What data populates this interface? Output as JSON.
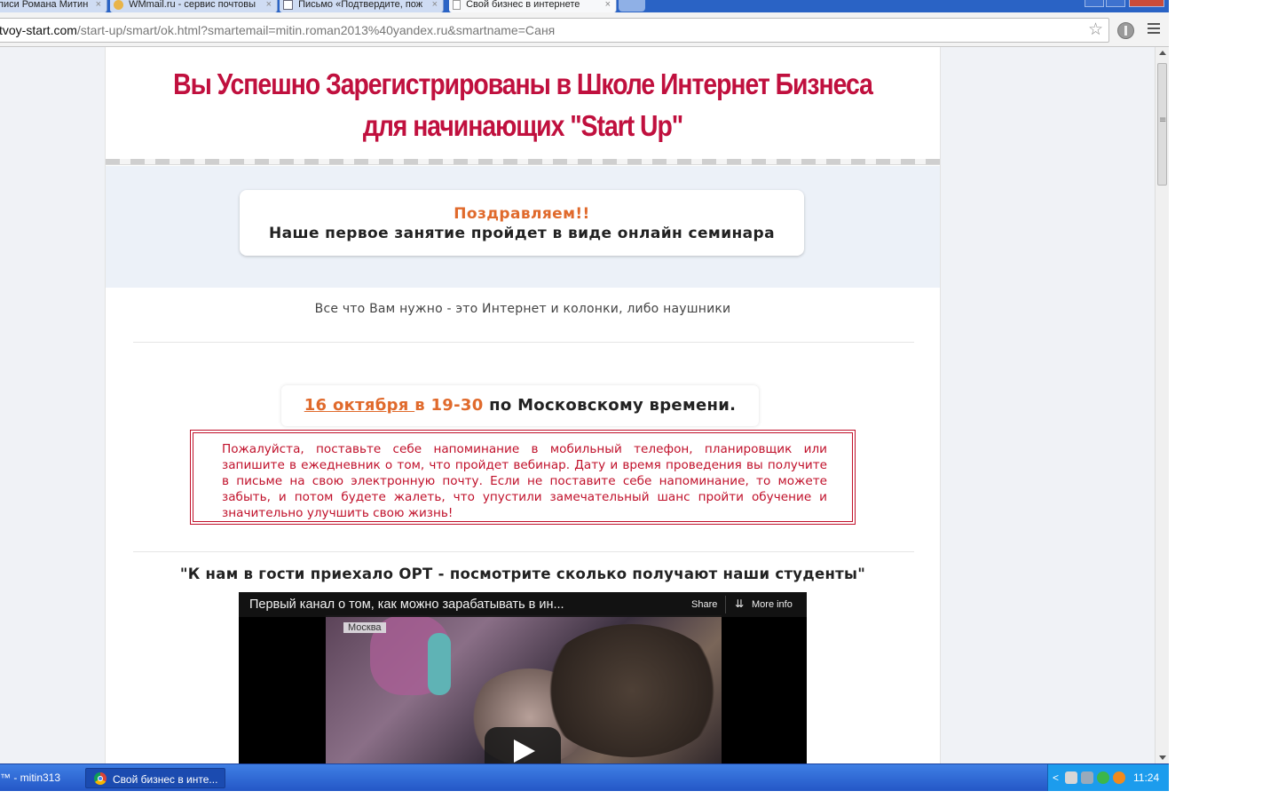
{
  "browser": {
    "tabs": [
      {
        "title": "писи Романа Митин",
        "active": false
      },
      {
        "title": "WMmail.ru - сервис почтовы",
        "active": false
      },
      {
        "title": "Письмо «Подтвердите, пож",
        "active": false
      },
      {
        "title": "Свой бизнес в интернете",
        "active": true
      }
    ],
    "tab_close_glyph": "×",
    "url_host": "tvoy-start.com",
    "url_path": "/start-up/smart/ok.html?smartemail=mitin.roman2013%40yandex.ru&smartname=Саня",
    "icons": [
      "star-icon",
      "extension-icon",
      "menu-icon"
    ]
  },
  "page": {
    "headline_line1": "Вы Успешно Зарегистрированы в Школе Интернет Бизнеса",
    "headline_line2": "для начинающих \"Start Up\"",
    "congrats_title": "Поздравляем!!",
    "congrats_text": "Наше первое занятие пройдет в виде онлайн семинара",
    "need_text": "Все что Вам нужно - это Интернет и колонки, либо наушники",
    "date_link": "16 октября ",
    "date_time": "в 19-30",
    "date_suffix": " по Московскому времени.",
    "reminder_text": "Пожалуйста, поставьте себе напоминание в мобильный телефон, планировщик или запишите в ежедневник о том, что пройдет вебинар. Дату и время проведения вы получите в письме на свою электронную почту. Если не поставите себе напоминание, то можете забыть, и потом будете жалеть, что упустили замечательный шанс пройти обучение и значительно улучшить свою жизнь!",
    "ort_heading": "\"К нам в гости приехало ОРТ - посмотрите сколько получают наши студенты\"",
    "video": {
      "title": "Первый канал о том, как можно зарабатывать в ин...",
      "share_label": "Share",
      "more_info_label": "More info",
      "caption_city": "Москва"
    },
    "colors": {
      "headline": "#c0103e",
      "accent_orange": "#e06a2c",
      "reminder_red": "#c0102a"
    }
  },
  "taskbar": {
    "left_item": "™ - mitin313",
    "active_window": "Свой бизнес в инте...",
    "clock": "11:24"
  }
}
